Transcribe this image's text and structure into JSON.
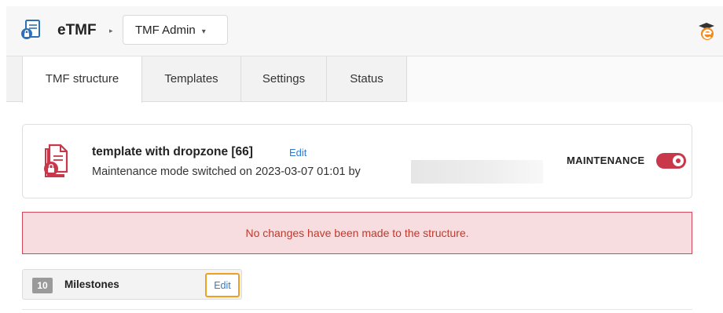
{
  "header": {
    "app_name": "eTMF",
    "breadcrumb_separator": "▸",
    "module_selector": "TMF Admin",
    "app_icon": "document-lock-icon",
    "user_logo_icon": "graduation-cap-logo-icon"
  },
  "tabs": [
    {
      "label": "TMF structure",
      "active": true
    },
    {
      "label": "Templates",
      "active": false
    },
    {
      "label": "Settings",
      "active": false
    },
    {
      "label": "Status",
      "active": false
    }
  ],
  "template_card": {
    "title": "template with dropzone [66]",
    "edit_label": "Edit",
    "status_text": "Maintenance mode switched on 2023-03-07 01:01 by",
    "maintenance_label": "MAINTENANCE",
    "maintenance_on": true,
    "icon": "template-lock-icon"
  },
  "alert": {
    "message": "No changes have been made to the structure."
  },
  "milestones": {
    "count": "10",
    "label": "Milestones",
    "edit_label": "Edit"
  },
  "colors": {
    "accent": "#c8384a",
    "link": "#2c7bd6",
    "alert_bg": "#f8dde0",
    "highlight": "#f0a020"
  }
}
